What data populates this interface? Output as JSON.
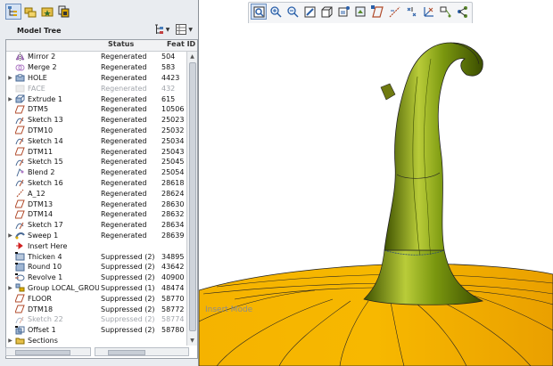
{
  "panel_toolbar": {
    "buttons": [
      {
        "name": "model-tree-tab",
        "icon": "tree-icon"
      },
      {
        "name": "folder-browser-tab",
        "icon": "folder-tree-icon"
      },
      {
        "name": "favorites-tab",
        "icon": "folder-star-icon"
      },
      {
        "name": "layers-tab",
        "icon": "layer-stack-icon"
      }
    ]
  },
  "model_tree": {
    "title": "Model Tree",
    "settings_icon": "tree-settings-icon",
    "show_icon": "show-columns-icon",
    "columns": {
      "name": "",
      "status": "Status",
      "feat_id": "Feat ID"
    },
    "rows": [
      {
        "label": "Mirror 2",
        "status": "Regenerated",
        "feat_id": "504",
        "icon": "mirror-icon",
        "expand": "",
        "state": "normal"
      },
      {
        "label": "Merge 2",
        "status": "Regenerated",
        "feat_id": "583",
        "icon": "merge-icon",
        "expand": "",
        "state": "normal"
      },
      {
        "label": "HOLE",
        "status": "Regenerated",
        "feat_id": "4423",
        "icon": "hole-icon",
        "expand": "▶",
        "state": "normal"
      },
      {
        "label": "FACE",
        "status": "Regenerated",
        "feat_id": "432",
        "icon": "face-icon",
        "expand": "",
        "state": "dim"
      },
      {
        "label": "Extrude 1",
        "status": "Regenerated",
        "feat_id": "615",
        "icon": "extrude-icon",
        "expand": "▶",
        "state": "normal"
      },
      {
        "label": "DTM5",
        "status": "Regenerated",
        "feat_id": "10506",
        "icon": "datum-plane-icon",
        "expand": "",
        "state": "normal"
      },
      {
        "label": "Sketch 13",
        "status": "Regenerated",
        "feat_id": "25023",
        "icon": "sketch-icon",
        "expand": "",
        "state": "normal"
      },
      {
        "label": "DTM10",
        "status": "Regenerated",
        "feat_id": "25032",
        "icon": "datum-plane-icon",
        "expand": "",
        "state": "normal"
      },
      {
        "label": "Sketch 14",
        "status": "Regenerated",
        "feat_id": "25034",
        "icon": "sketch-icon",
        "expand": "",
        "state": "normal"
      },
      {
        "label": "DTM11",
        "status": "Regenerated",
        "feat_id": "25043",
        "icon": "datum-plane-icon",
        "expand": "",
        "state": "normal"
      },
      {
        "label": "Sketch 15",
        "status": "Regenerated",
        "feat_id": "25045",
        "icon": "sketch-icon",
        "expand": "",
        "state": "normal"
      },
      {
        "label": "Blend 2",
        "status": "Regenerated",
        "feat_id": "25054",
        "icon": "blend-icon",
        "expand": "",
        "state": "normal"
      },
      {
        "label": "Sketch 16",
        "status": "Regenerated",
        "feat_id": "28618",
        "icon": "sketch-icon",
        "expand": "",
        "state": "normal"
      },
      {
        "label": "A_12",
        "status": "Regenerated",
        "feat_id": "28624",
        "icon": "datum-axis-icon",
        "expand": "",
        "state": "normal"
      },
      {
        "label": "DTM13",
        "status": "Regenerated",
        "feat_id": "28630",
        "icon": "datum-plane-icon",
        "expand": "",
        "state": "normal"
      },
      {
        "label": "DTM14",
        "status": "Regenerated",
        "feat_id": "28632",
        "icon": "datum-plane-icon",
        "expand": "",
        "state": "normal"
      },
      {
        "label": "Sketch 17",
        "status": "Regenerated",
        "feat_id": "28634",
        "icon": "sketch-icon",
        "expand": "",
        "state": "normal"
      },
      {
        "label": "Sweep 1",
        "status": "Regenerated",
        "feat_id": "28639",
        "icon": "sweep-icon",
        "expand": "▶",
        "state": "normal"
      },
      {
        "label": "Insert Here",
        "status": "",
        "feat_id": "",
        "icon": "insert-arrow-icon",
        "expand": "",
        "state": "insert"
      },
      {
        "label": "Thicken 4",
        "status": "Suppressed (2)",
        "feat_id": "34895",
        "icon": "thicken-icon",
        "expand": "",
        "state": "normal"
      },
      {
        "label": "Round 10",
        "status": "Suppressed (2)",
        "feat_id": "43642",
        "icon": "round-icon",
        "expand": "",
        "state": "normal"
      },
      {
        "label": "Revolve 1",
        "status": "Suppressed (2)",
        "feat_id": "40900",
        "icon": "revolve-icon",
        "expand": "",
        "state": "normal"
      },
      {
        "label": "Group LOCAL_GROUP",
        "status": "Suppressed (1)",
        "feat_id": "48474",
        "icon": "group-icon",
        "expand": "▶",
        "state": "normal"
      },
      {
        "label": "FLOOR",
        "status": "Suppressed (2)",
        "feat_id": "58770",
        "icon": "datum-plane-icon",
        "expand": "",
        "state": "normal"
      },
      {
        "label": "DTM18",
        "status": "Suppressed (2)",
        "feat_id": "58772",
        "icon": "datum-plane-icon",
        "expand": "",
        "state": "normal"
      },
      {
        "label": "Sketch 22",
        "status": "Suppressed (2)",
        "feat_id": "58774",
        "icon": "sketch-icon",
        "expand": "",
        "state": "dim"
      },
      {
        "label": "Offset 1",
        "status": "Suppressed (2)",
        "feat_id": "58780",
        "icon": "offset-icon",
        "expand": "",
        "state": "normal"
      },
      {
        "label": "Sections",
        "status": "",
        "feat_id": "",
        "icon": "folder-icon",
        "expand": "▶",
        "state": "normal"
      }
    ]
  },
  "view_toolbar": {
    "buttons": [
      {
        "name": "refit-button",
        "icon": "refit-icon"
      },
      {
        "name": "zoom-in-button",
        "icon": "zoom-in-icon"
      },
      {
        "name": "zoom-out-button",
        "icon": "zoom-out-icon"
      },
      {
        "name": "repaint-button",
        "icon": "repaint-icon"
      },
      {
        "name": "display-style-button",
        "icon": "display-style-icon"
      },
      {
        "name": "saved-views-button",
        "icon": "saved-views-icon"
      },
      {
        "name": "view-manager-button",
        "icon": "view-manager-icon"
      },
      {
        "name": "plane-display-button",
        "icon": "datum-plane-display-icon"
      },
      {
        "name": "axis-display-button",
        "icon": "datum-axis-display-icon"
      },
      {
        "name": "point-display-button",
        "icon": "datum-point-display-icon"
      },
      {
        "name": "csys-display-button",
        "icon": "csys-display-icon"
      },
      {
        "name": "annotation-display-button",
        "icon": "annotation-display-icon"
      },
      {
        "name": "spin-center-button",
        "icon": "spin-center-icon"
      }
    ]
  },
  "viewport": {
    "watermark": "Insert Mode",
    "colors": {
      "pumpkin": "#f4a900",
      "stem": "#6f8d0a",
      "edges": "#1e1e1e"
    }
  }
}
